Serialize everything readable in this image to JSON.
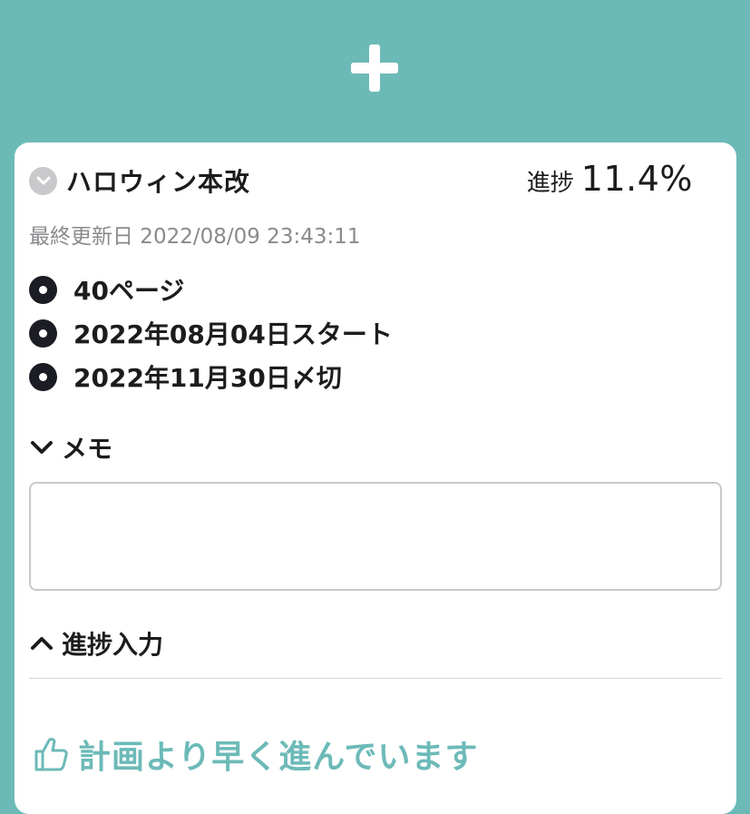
{
  "header": {
    "add_icon": "plus-icon",
    "background_color": "#6cbab8"
  },
  "card": {
    "collapse_icon": "chevron-down-circle-icon",
    "title": "ハロウィン本改",
    "progress_label": "進捗",
    "progress_value": "11.4%",
    "last_updated": "最終更新日 2022/08/09 23:43:11",
    "details": [
      {
        "icon": "bullet-icon",
        "text": "40ページ"
      },
      {
        "icon": "bullet-icon",
        "text": "2022年08月04日スタート"
      },
      {
        "icon": "bullet-icon",
        "text": "2022年11月30日〆切"
      }
    ],
    "memo": {
      "icon": "chevron-down-icon",
      "label": "メモ",
      "value": ""
    },
    "progress_input": {
      "icon": "chevron-up-icon",
      "label": "進捗入力"
    },
    "status": {
      "icon": "thumbs-up-icon",
      "text": "計画より早く進んでいます",
      "color": "#6cbab8"
    }
  }
}
